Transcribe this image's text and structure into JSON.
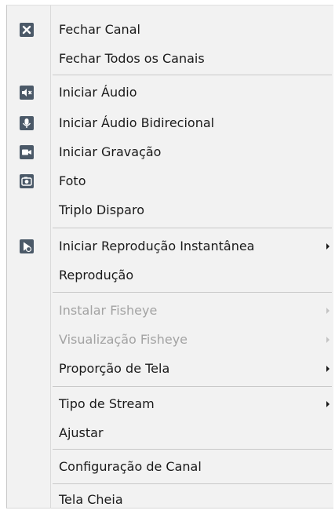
{
  "menu": {
    "items": [
      {
        "label": "Fechar Canal",
        "icon": "close-icon",
        "enabled": true,
        "submenu": false
      },
      {
        "label": "Fechar Todos os Canais",
        "icon": null,
        "enabled": true,
        "submenu": false
      },
      {
        "label": "Iniciar Áudio",
        "icon": "speaker-muted-icon",
        "enabled": true,
        "submenu": false
      },
      {
        "label": "Iniciar Áudio Bidirecional",
        "icon": "microphone-icon",
        "enabled": true,
        "submenu": false
      },
      {
        "label": "Iniciar Gravação",
        "icon": "video-camera-icon",
        "enabled": true,
        "submenu": false
      },
      {
        "label": "Foto",
        "icon": "camera-icon",
        "enabled": true,
        "submenu": false
      },
      {
        "label": "Triplo Disparo",
        "icon": null,
        "enabled": true,
        "submenu": false
      },
      {
        "label": "Iniciar Reprodução Instantânea",
        "icon": "instant-playback-icon",
        "enabled": true,
        "submenu": true
      },
      {
        "label": "Reprodução",
        "icon": null,
        "enabled": true,
        "submenu": false
      },
      {
        "label": "Instalar Fisheye",
        "icon": null,
        "enabled": false,
        "submenu": true
      },
      {
        "label": "Visualização Fisheye",
        "icon": null,
        "enabled": false,
        "submenu": true
      },
      {
        "label": "Proporção de Tela",
        "icon": null,
        "enabled": true,
        "submenu": true
      },
      {
        "label": "Tipo de Stream",
        "icon": null,
        "enabled": true,
        "submenu": true
      },
      {
        "label": "Ajustar",
        "icon": null,
        "enabled": true,
        "submenu": false
      },
      {
        "label": "Configuração de Canal",
        "icon": null,
        "enabled": true,
        "submenu": false
      },
      {
        "label": "Tela Cheia",
        "icon": null,
        "enabled": true,
        "submenu": false
      }
    ]
  },
  "colors": {
    "icon": "#4b5968",
    "text": "#1a1a1a",
    "disabled_text": "#a3a3a3",
    "background": "#f2f2f2"
  }
}
